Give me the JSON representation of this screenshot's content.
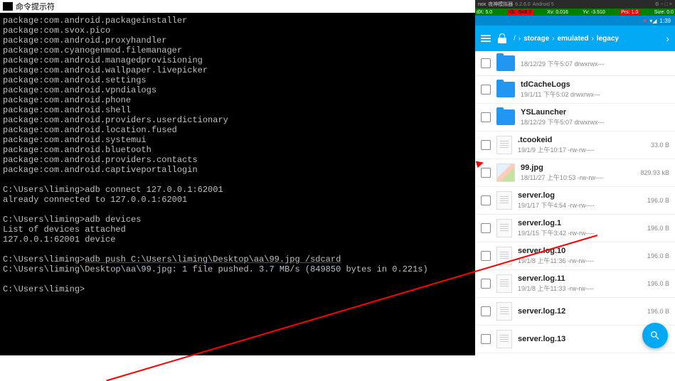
{
  "terminal": {
    "title": "命令提示符",
    "lines": [
      "package:com.android.packageinstaller",
      "package:com.svox.pico",
      "package:com.android.proxyhandler",
      "package:com.cyanogenmod.filemanager",
      "package:com.android.managedprovisioning",
      "package:com.android.wallpaper.livepicker",
      "package:com.android.settings",
      "package:com.android.vpndialogs",
      "package:com.android.phone",
      "package:com.android.shell",
      "package:com.android.providers.userdictionary",
      "package:com.android.location.fused",
      "package:com.android.systemui",
      "package:com.android.bluetooth",
      "package:com.android.providers.contacts",
      "package:com.android.captiveportallogin",
      "",
      "C:\\Users\\liming>adb connect 127.0.0.1:62001",
      "already connected to 127.0.0.1:62001",
      "",
      "C:\\Users\\liming>adb devices",
      "List of devices attached",
      "127.0.0.1:62001 device",
      ""
    ],
    "push_prompt": "C:\\Users\\liming>",
    "push_cmd": "adb push C:\\Users\\liming\\Desktop\\aa\\99.jpg /sdcard",
    "push_result": "C:\\Users\\liming\\Desktop\\aa\\99.jpg: 1 file pushed. 3.7 MB/s (849850 bytes in 0.221s)",
    "final_prompt": "C:\\Users\\liming>"
  },
  "nox": {
    "title": "夜神模拟器",
    "version": "6.2.6.0",
    "platform": "Android 5",
    "debug": {
      "dx": "dX: 5.0",
      "xb": "Xb: -548.5",
      "xv": "Xv: 0.016",
      "yv": "Yv: -3.510",
      "prs": "Prs: 1.0",
      "size": "Size: 0.0"
    },
    "time": "1:39"
  },
  "explorer": {
    "breadcrumb": [
      "storage",
      "emulated",
      "legacy"
    ],
    "rows": [
      {
        "type": "folder",
        "name": "",
        "meta": "18/12/29 下午5:07  drwxrwx---",
        "size": ""
      },
      {
        "type": "folder",
        "name": "tdCacheLogs",
        "meta": "19/1/11 下午5:02  drwxrwx---",
        "size": ""
      },
      {
        "type": "folder",
        "name": "YSLauncher",
        "meta": "18/12/29 下午5:07  drwxrwx---",
        "size": ""
      },
      {
        "type": "file",
        "name": ".tcookeid",
        "meta": "19/1/9 上午10:17  -rw-rw----",
        "size": "33.0 B"
      },
      {
        "type": "image",
        "name": "99.jpg",
        "meta": "18/11/27 上午10:53  -rw-rw----",
        "size": "829.93 kB"
      },
      {
        "type": "file",
        "name": "server.log",
        "meta": "19/1/17 下午4:54  -rw-rw----",
        "size": "196.0 B"
      },
      {
        "type": "file",
        "name": "server.log.1",
        "meta": "19/1/15 下午3:42  -rw-rw----",
        "size": "196.0 B"
      },
      {
        "type": "file",
        "name": "server.log.10",
        "meta": "19/1/8 上午11:36  -rw-rw----",
        "size": "196.0 B"
      },
      {
        "type": "file",
        "name": "server.log.11",
        "meta": "19/1/8 上午11:33  -rw-rw----",
        "size": "196.0 B"
      },
      {
        "type": "file",
        "name": "server.log.12",
        "meta": "",
        "size": "196.0 B"
      },
      {
        "type": "file",
        "name": "server.log.13",
        "meta": "",
        "size": ""
      }
    ]
  }
}
